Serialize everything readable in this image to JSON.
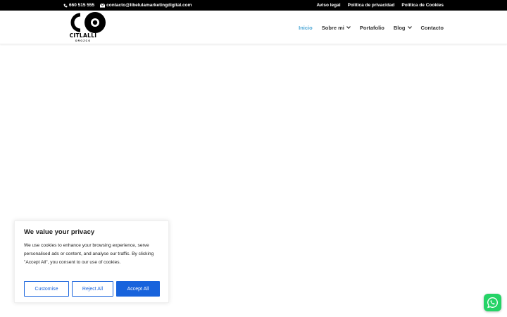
{
  "topbar": {
    "phone": "660 515 555",
    "email": "contacto@libelulamarketingdigital.com",
    "links": [
      "Aviso legal",
      "Política de privacidad",
      "Política de Cookies"
    ]
  },
  "header": {
    "logo_text": "CITLALLI",
    "logo_subtext": "OROZCO",
    "nav": [
      {
        "label": "Inicio",
        "active": true,
        "dropdown": false
      },
      {
        "label": "Sobre mi",
        "active": false,
        "dropdown": true
      },
      {
        "label": "Portafolio",
        "active": false,
        "dropdown": false
      },
      {
        "label": "Blog",
        "active": false,
        "dropdown": true
      },
      {
        "label": "Contacto",
        "active": false,
        "dropdown": false
      }
    ]
  },
  "cookie_banner": {
    "title": "We value your privacy",
    "text": "We use cookies to enhance your browsing experience, serve personalised ads or content, and analyse our traffic. By clicking \"Accept All\", you consent to our use of cookies.",
    "customise_label": "Customise",
    "reject_label": "Reject All",
    "accept_label": "Accept All"
  },
  "colors": {
    "accent": "#4ea8d6",
    "cookie_button": "#1863dc",
    "whatsapp": "#25d366"
  },
  "icons": {
    "phone": "phone-icon",
    "email": "envelope-icon",
    "chevron": "chevron-down-icon",
    "whatsapp": "whatsapp-icon"
  }
}
